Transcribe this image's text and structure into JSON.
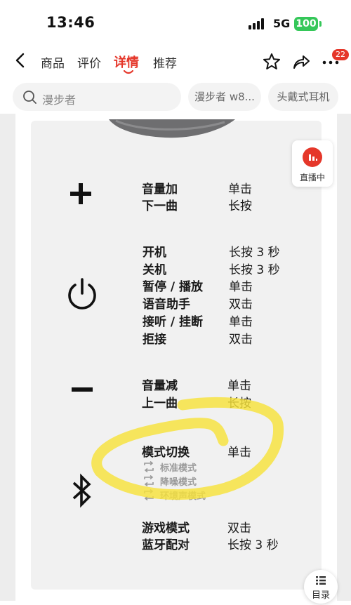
{
  "status_bar": {
    "time": "13:46",
    "network": "5G",
    "battery": "100"
  },
  "nav": {
    "tabs": [
      "商品",
      "评价",
      "详情",
      "推荐"
    ],
    "active_tab": "详情",
    "badge": "22"
  },
  "search": {
    "query": "漫步者",
    "chips": [
      "漫步者 w8...",
      "头戴式耳机"
    ]
  },
  "live": {
    "label": "直播中"
  },
  "toc": {
    "label": "目录"
  },
  "controls": {
    "plus": {
      "rows": [
        {
          "action": "音量加",
          "gesture": "单击"
        },
        {
          "action": "下一曲",
          "gesture": "长按"
        }
      ]
    },
    "power": {
      "rows": [
        {
          "action": "开机",
          "gesture": "长按 3 秒"
        },
        {
          "action": "关机",
          "gesture": "长按 3 秒"
        },
        {
          "action": "暂停 / 播放",
          "gesture": "单击"
        },
        {
          "action": "语音助手",
          "gesture": "双击"
        },
        {
          "action": "接听 / 挂断",
          "gesture": "单击"
        },
        {
          "action": "拒接",
          "gesture": "双击"
        }
      ]
    },
    "minus": {
      "rows": [
        {
          "action": "音量减",
          "gesture": "单击"
        },
        {
          "action": "上一曲",
          "gesture": "长按"
        }
      ]
    },
    "bluetooth": {
      "mode_switch": {
        "action": "模式切换",
        "gesture": "单击"
      },
      "modes": [
        "标准模式",
        "降噪模式",
        "环境声模式"
      ],
      "rows": [
        {
          "action": "游戏模式",
          "gesture": "双击"
        },
        {
          "action": "蓝牙配对",
          "gesture": "长按 3 秒"
        }
      ]
    }
  },
  "colors": {
    "accent": "#e5372a",
    "battery": "#35c759",
    "highlight": "#f7e23a"
  }
}
